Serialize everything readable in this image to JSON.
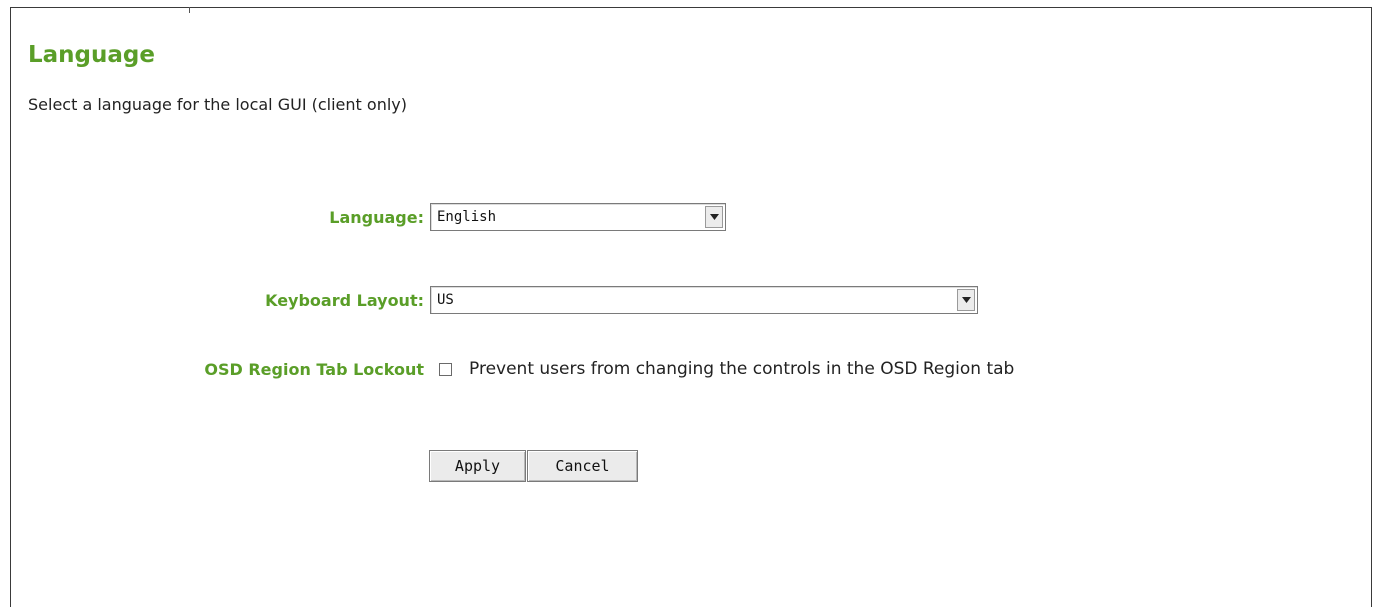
{
  "page": {
    "title": "Language",
    "subtitle": "Select a language for the local GUI (client only)"
  },
  "form": {
    "language": {
      "label": "Language:",
      "value": "English"
    },
    "keyboard_layout": {
      "label": "Keyboard Layout:",
      "value": "US"
    },
    "osd_lockout": {
      "label": "OSD Region Tab Lockout",
      "checkbox_text": "Prevent users from changing the controls in the OSD Region tab",
      "checked": false
    }
  },
  "buttons": {
    "apply": "Apply",
    "cancel": "Cancel"
  },
  "colors": {
    "label_green": "#5a9e28",
    "border": "#3a3a3a"
  },
  "icons": {
    "dropdown": "chevron-down-icon"
  }
}
